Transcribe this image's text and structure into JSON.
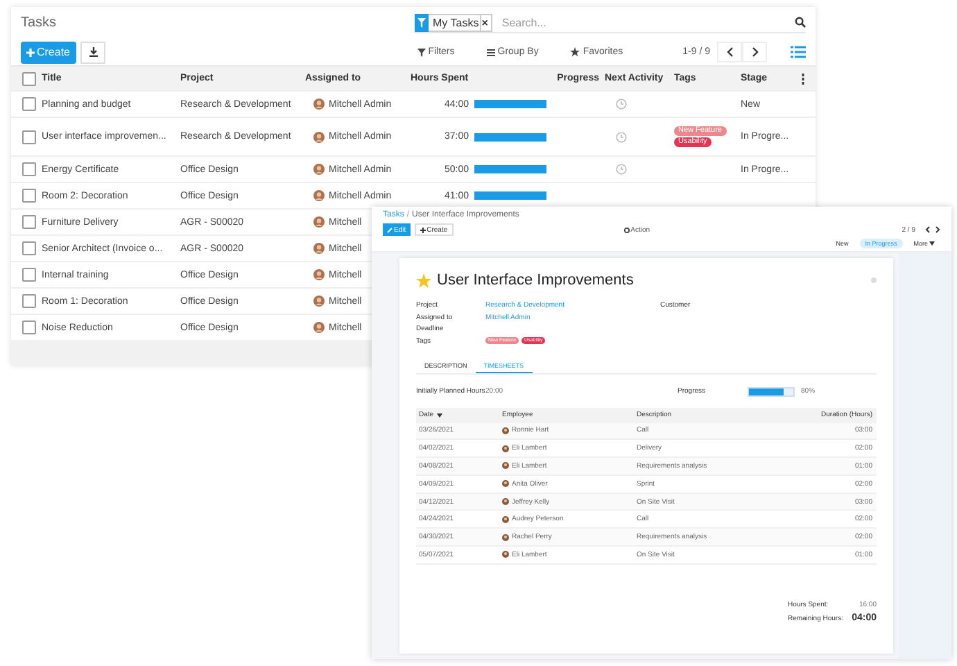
{
  "list_view": {
    "title": "Tasks",
    "facet": {
      "label": "My Tasks",
      "remove": "×"
    },
    "search": {
      "placeholder": "Search..."
    },
    "create_button": "Create",
    "filters": "Filters",
    "group_by": "Group By",
    "favorites": "Favorites",
    "pager": "1-9 / 9",
    "select_all": {
      "checked": false
    },
    "columns": [
      "Title",
      "Project",
      "Assigned to",
      "Hours Spent",
      "Progress",
      "Next Activity",
      "Tags",
      "Stage"
    ],
    "rows": [
      {
        "checked": false,
        "title": "Planning and budget",
        "project": "Research & Development",
        "assignee": "Mitchell Admin",
        "hours": "44:00",
        "level": 1,
        "activity": true,
        "tags": [],
        "stage": "New"
      },
      {
        "checked": false,
        "title": "User interface improvemen...",
        "project": "Research & Development",
        "assignee": "Mitchell Admin",
        "hours": "37:00",
        "level": 1,
        "activity": true,
        "tags": [
          {
            "label": "New Feature",
            "color": "#f0868a"
          },
          {
            "label": "Usability",
            "color": "#e6334f"
          }
        ],
        "stage": "In Progre..."
      },
      {
        "checked": false,
        "title": "Energy Certificate",
        "project": "Office Design",
        "assignee": "Mitchell Admin",
        "hours": "50:00",
        "level": 1,
        "activity": true,
        "tags": [],
        "stage": "In Progre..."
      },
      {
        "checked": false,
        "title": "Room 2: Decoration",
        "project": "Office Design",
        "assignee": "Mitchell Admin",
        "hours": "41:00",
        "level": 1,
        "tags": []
      },
      {
        "checked": false,
        "title": "Furniture Delivery",
        "project": "AGR - S00020",
        "assignee": "Mitchell",
        "tags": []
      },
      {
        "checked": false,
        "title": "Senior Architect (Invoice o...",
        "project": "AGR - S00020",
        "assignee": "Mitchell",
        "tags": []
      },
      {
        "checked": false,
        "title": "Internal training",
        "project": "Office Design",
        "assignee": "Mitchell",
        "tags": []
      },
      {
        "checked": false,
        "title": "Room 1: Decoration",
        "project": "Office Design",
        "assignee": "Mitchell",
        "tags": []
      },
      {
        "checked": false,
        "title": "Noise Reduction",
        "project": "Office Design",
        "assignee": "Mitchell",
        "tags": []
      }
    ]
  },
  "form_view": {
    "breadcrumb": [
      "Tasks",
      "User Interface Improvements"
    ],
    "breadcrumb_separator": "/",
    "edit_button": "Edit",
    "create_button": "Create",
    "action": "Action",
    "pager": "2 / 9",
    "stages": [
      {
        "label": "New",
        "selected": false
      },
      {
        "label": "In Progress",
        "selected": true
      }
    ],
    "more": "More",
    "task": {
      "starred": true,
      "title": "User Interface Improvements",
      "fields": [
        {
          "label": "Project",
          "value": "Research & Development"
        },
        {
          "label": "Assigned to",
          "value": "Mitchell Admin"
        },
        {
          "label": "Deadline"
        }
      ],
      "tags_label": "Tags",
      "tags": [
        {
          "label": "New Feature",
          "color": "#f0868a"
        },
        {
          "label": "Usability",
          "color": "#e6334f"
        }
      ],
      "customer_label": "Customer",
      "tabs": [
        {
          "label": "DESCRIPTION",
          "selected": false
        },
        {
          "label": "TIMESHEETS",
          "selected": true
        }
      ],
      "planned_label": "Initially Planned Hours",
      "planned_value": "20:00",
      "progress_label": "Progress",
      "progress": {
        "level": 0.8,
        "reading": "80%"
      },
      "timesheet_columns": [
        "Date",
        "Employee",
        "Description",
        "Duration (Hours)"
      ],
      "timesheets": [
        {
          "date": "03/26/2021",
          "employee": "Ronnie Hart",
          "description": "Call",
          "duration": "03:00"
        },
        {
          "date": "04/02/2021",
          "employee": "Eli Lambert",
          "description": "Delivery",
          "duration": "02:00"
        },
        {
          "date": "04/08/2021",
          "employee": "Eli Lambert",
          "description": "Requirements analysis",
          "duration": "01:00"
        },
        {
          "date": "04/09/2021",
          "employee": "Anita Oliver",
          "description": "Sprint",
          "duration": "02:00"
        },
        {
          "date": "04/12/2021",
          "employee": "Jeffrey Kelly",
          "description": "On Site Visit",
          "duration": "03:00"
        },
        {
          "date": "04/24/2021",
          "employee": "Audrey Peterson",
          "description": "Call",
          "duration": "02:00"
        },
        {
          "date": "04/30/2021",
          "employee": "Rachel Perry",
          "description": "Requirements analysis",
          "duration": "02:00"
        },
        {
          "date": "05/07/2021",
          "employee": "Eli Lambert",
          "description": "On Site Visit",
          "duration": "01:00"
        }
      ],
      "hours_spent_label": "Hours Spent:",
      "hours_spent": "16:00",
      "remaining_label": "Remaining Hours:",
      "remaining": "04:00"
    }
  }
}
